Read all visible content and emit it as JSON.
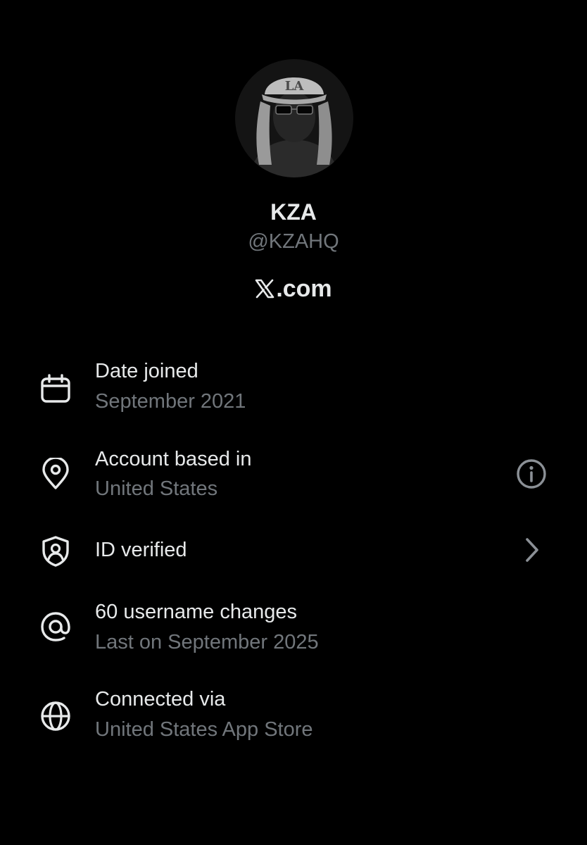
{
  "profile": {
    "name": "KZA",
    "handle": "@KZAHQ",
    "avatar_icon": "user-avatar-photo"
  },
  "brand": {
    "logo_icon": "x-logo-icon",
    "suffix": ".com"
  },
  "info_rows": [
    {
      "icon": "calendar-icon",
      "title": "Date joined",
      "subtitle": "September 2021"
    },
    {
      "icon": "location-pin-icon",
      "title": "Account based in",
      "subtitle": "United States",
      "action_icon": "info-icon"
    },
    {
      "icon": "shield-user-icon",
      "title": "ID verified",
      "action_icon": "chevron-right-icon"
    },
    {
      "icon": "at-sign-icon",
      "title": "60 username changes",
      "subtitle": "Last on September 2025"
    },
    {
      "icon": "globe-icon",
      "title": "Connected via",
      "subtitle": "United States App Store"
    }
  ],
  "colors": {
    "background": "#000000",
    "primary_text": "#e7e9ea",
    "secondary_text": "#71767b",
    "icon_action": "#8b9096"
  }
}
